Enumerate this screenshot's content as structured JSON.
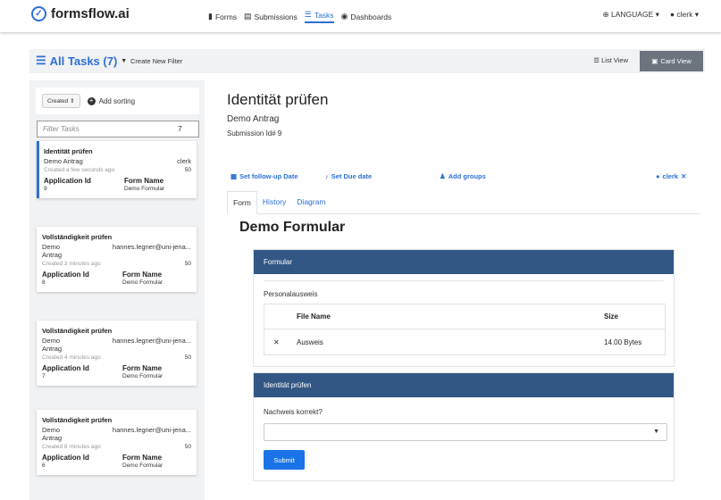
{
  "brand": {
    "name": "formsflow.ai"
  },
  "nav": {
    "links": [
      {
        "label": "Forms",
        "icon": "file-icon"
      },
      {
        "label": "Submissions",
        "icon": "list-box-icon"
      },
      {
        "label": "Tasks",
        "icon": "tasks-icon"
      },
      {
        "label": "Dashboards",
        "icon": "dashboard-icon"
      }
    ],
    "language": "LANGUAGE",
    "user": "clerk"
  },
  "header": {
    "all_tasks": "All Tasks (7)",
    "create_filter": "Create New Filter",
    "list_view": "List View",
    "card_view": "Card View"
  },
  "sidebar": {
    "sort_created": "Created",
    "add_sorting": "Add sorting",
    "filter_placeholder": "Filter Tasks",
    "filter_count": "7",
    "tasks": [
      {
        "name": "Identität prüfen",
        "product": "Demo Antrag",
        "assignee": "clerk",
        "created": "Created a few seconds ago",
        "priority": "50",
        "app_id_label": "Application Id",
        "app_id": "9",
        "form_name_label": "Form Name",
        "form_name": "Demo Formular"
      },
      {
        "name": "Vollständigkeit prüfen",
        "product": "Demo Antrag",
        "product_line1": "Demo",
        "product_line2": "Antrag",
        "assignee": "hannes.legner@uni-jena...",
        "created": "Created 3 minutes ago",
        "priority": "50",
        "app_id_label": "Application Id",
        "app_id": "8",
        "form_name_label": "Form Name",
        "form_name": "Demo Formular"
      },
      {
        "name": "Vollständigkeit prüfen",
        "product_line1": "Demo",
        "product_line2": "Antrag",
        "assignee": "hannes.legner@uni-jena...",
        "created": "Created 4 minutes ago",
        "priority": "50",
        "app_id_label": "Application Id",
        "app_id": "7",
        "form_name_label": "Form Name",
        "form_name": "Demo Formular"
      },
      {
        "name": "Vollständigkeit prüfen",
        "product_line1": "Demo",
        "product_line2": "Antrag",
        "assignee": "hannes.legner@uni-jena...",
        "created": "Created 8 minutes ago",
        "priority": "50",
        "app_id_label": "Application Id",
        "app_id": "6",
        "form_name_label": "Form Name",
        "form_name": "Demo Formular"
      }
    ]
  },
  "task": {
    "title": "Identität prüfen",
    "subtitle": "Demo Antrag",
    "submission": "Submission Id# 9",
    "actions": {
      "follow_up": "Set follow-up Date",
      "due_date": "Set Due date",
      "add_groups": "Add groups",
      "assignee": "clerk"
    },
    "tabs": [
      "Form",
      "History",
      "Diagram"
    ]
  },
  "form": {
    "title": "Demo Formular",
    "panel1_title": "Formular",
    "personalausweis_label": "Personalausweis",
    "file_headers": {
      "name": "File Name",
      "size": "Size"
    },
    "files": [
      {
        "name": "Ausweis",
        "size": "14.00 Bytes"
      }
    ],
    "panel2_title": "Identität prüfen",
    "question": "Nachweis korrekt?",
    "submit": "Submit"
  },
  "colors": {
    "accent": "#2d6fd6",
    "panel_header": "#335784",
    "submit": "#1a73e8"
  }
}
